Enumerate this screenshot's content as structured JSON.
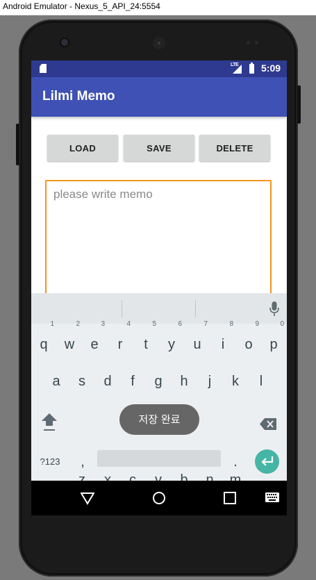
{
  "window": {
    "title": "Android Emulator - Nexus_5_API_24:5554"
  },
  "status_bar": {
    "time": "5:09",
    "network": "LTE",
    "bg_color": "#2e3a8f",
    "icons": [
      "sd-card-icon",
      "signal-icon",
      "battery-icon"
    ]
  },
  "app_bar": {
    "title": "Lilmi Memo",
    "color": "#3f51b5"
  },
  "buttons": {
    "load": "LOAD",
    "save": "SAVE",
    "delete": "DELETE"
  },
  "memo": {
    "placeholder": "please write memo",
    "value": "",
    "border_color": "#f7941d"
  },
  "keyboard": {
    "row1": [
      {
        "key": "q",
        "hint": "1"
      },
      {
        "key": "w",
        "hint": "2"
      },
      {
        "key": "e",
        "hint": "3"
      },
      {
        "key": "r",
        "hint": "4"
      },
      {
        "key": "t",
        "hint": "5"
      },
      {
        "key": "y",
        "hint": "6"
      },
      {
        "key": "u",
        "hint": "7"
      },
      {
        "key": "i",
        "hint": "8"
      },
      {
        "key": "o",
        "hint": "9"
      },
      {
        "key": "p",
        "hint": "0"
      }
    ],
    "row2": [
      "a",
      "s",
      "d",
      "f",
      "g",
      "h",
      "j",
      "k",
      "l"
    ],
    "row3": [
      "z",
      "x",
      "c",
      "v",
      "b",
      "n",
      "m"
    ],
    "symbols_label": "?123",
    "comma": ",",
    "period": ".",
    "enter_color": "#46b5a5"
  },
  "toast": {
    "message": "저장 완료"
  },
  "nav_bar": {
    "icons": [
      "back-icon",
      "home-icon",
      "recents-icon",
      "keyboard-switch-icon"
    ]
  }
}
